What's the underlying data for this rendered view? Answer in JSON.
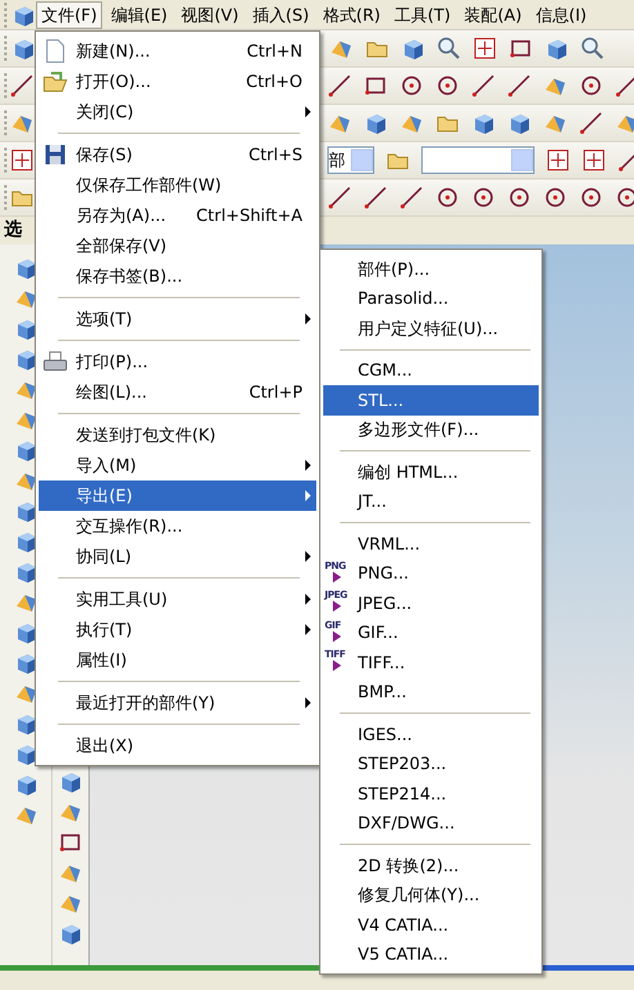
{
  "menubar": [
    {
      "label": "文件(F)",
      "selected": true
    },
    {
      "label": "编辑(E)",
      "selected": false
    },
    {
      "label": "视图(V)",
      "selected": false
    },
    {
      "label": "插入(S)",
      "selected": false
    },
    {
      "label": "格式(R)",
      "selected": false
    },
    {
      "label": "工具(T)",
      "selected": false
    },
    {
      "label": "装配(A)",
      "selected": false
    },
    {
      "label": "信息(I)",
      "selected": false
    }
  ],
  "part_combo": {
    "value": "部"
  },
  "panel_title": "选",
  "file_menu": [
    {
      "kind": "item",
      "label": "新建(N)...",
      "shortcut": "Ctrl+N",
      "submenu": false,
      "selected": false
    },
    {
      "kind": "item",
      "label": "打开(O)...",
      "shortcut": "Ctrl+O",
      "submenu": false,
      "selected": false
    },
    {
      "kind": "item",
      "label": "关闭(C)",
      "submenu": true,
      "selected": false
    },
    {
      "kind": "separator"
    },
    {
      "kind": "item",
      "label": "保存(S)",
      "shortcut": "Ctrl+S",
      "submenu": false,
      "selected": false
    },
    {
      "kind": "item",
      "label": "仅保存工作部件(W)",
      "submenu": false,
      "selected": false
    },
    {
      "kind": "item",
      "label": "另存为(A)...",
      "shortcut": "Ctrl+Shift+A",
      "submenu": false,
      "selected": false
    },
    {
      "kind": "item",
      "label": "全部保存(V)",
      "submenu": false,
      "selected": false
    },
    {
      "kind": "item",
      "label": "保存书签(B)...",
      "submenu": false,
      "selected": false
    },
    {
      "kind": "separator"
    },
    {
      "kind": "item",
      "label": "选项(T)",
      "submenu": true,
      "selected": false
    },
    {
      "kind": "separator"
    },
    {
      "kind": "item",
      "label": "打印(P)...",
      "submenu": false,
      "selected": false
    },
    {
      "kind": "item",
      "label": "绘图(L)...",
      "shortcut": "Ctrl+P",
      "submenu": false,
      "selected": false
    },
    {
      "kind": "separator"
    },
    {
      "kind": "item",
      "label": "发送到打包文件(K)",
      "submenu": false,
      "selected": false
    },
    {
      "kind": "item",
      "label": "导入(M)",
      "submenu": true,
      "selected": false
    },
    {
      "kind": "item",
      "label": "导出(E)",
      "submenu": true,
      "selected": true
    },
    {
      "kind": "item",
      "label": "交互操作(R)...",
      "submenu": false,
      "selected": false
    },
    {
      "kind": "item",
      "label": "协同(L)",
      "submenu": true,
      "selected": false
    },
    {
      "kind": "separator"
    },
    {
      "kind": "item",
      "label": "实用工具(U)",
      "submenu": true,
      "selected": false
    },
    {
      "kind": "item",
      "label": "执行(T)",
      "submenu": true,
      "selected": false
    },
    {
      "kind": "item",
      "label": "属性(I)",
      "submenu": false,
      "selected": false
    },
    {
      "kind": "separator"
    },
    {
      "kind": "item",
      "label": "最近打开的部件(Y)",
      "submenu": true,
      "selected": false
    },
    {
      "kind": "separator"
    },
    {
      "kind": "item",
      "label": "退出(X)",
      "submenu": false,
      "selected": false
    }
  ],
  "export_submenu": [
    {
      "kind": "item",
      "label": "部件(P)...",
      "selected": false
    },
    {
      "kind": "item",
      "label": "Parasolid...",
      "selected": false
    },
    {
      "kind": "item",
      "label": "用户定义特征(U)...",
      "selected": false
    },
    {
      "kind": "separator"
    },
    {
      "kind": "item",
      "label": "CGM...",
      "selected": false
    },
    {
      "kind": "item",
      "label": "STL...",
      "selected": true
    },
    {
      "kind": "item",
      "label": "多边形文件(F)...",
      "selected": false
    },
    {
      "kind": "separator"
    },
    {
      "kind": "item",
      "label": "编创 HTML...",
      "selected": false
    },
    {
      "kind": "item",
      "label": "JT...",
      "selected": false
    },
    {
      "kind": "separator"
    },
    {
      "kind": "item",
      "label": "VRML...",
      "selected": false
    },
    {
      "kind": "item",
      "badge": "PNG",
      "label": "PNG...",
      "selected": false
    },
    {
      "kind": "item",
      "badge": "JPEG",
      "label": "JPEG...",
      "selected": false
    },
    {
      "kind": "item",
      "badge": "GIF",
      "label": "GIF...",
      "selected": false
    },
    {
      "kind": "item",
      "badge": "TIFF",
      "label": "TIFF...",
      "selected": false
    },
    {
      "kind": "item",
      "label": "BMP...",
      "selected": false
    },
    {
      "kind": "separator"
    },
    {
      "kind": "item",
      "label": "IGES...",
      "selected": false
    },
    {
      "kind": "item",
      "label": "STEP203...",
      "selected": false
    },
    {
      "kind": "item",
      "label": "STEP214...",
      "selected": false
    },
    {
      "kind": "item",
      "label": "DXF/DWG...",
      "selected": false
    },
    {
      "kind": "separator"
    },
    {
      "kind": "item",
      "label": "2D 转换(2)...",
      "selected": false
    },
    {
      "kind": "item",
      "label": "修复几何体(Y)...",
      "selected": false
    },
    {
      "kind": "item",
      "label": "V4 CATIA...",
      "selected": false
    },
    {
      "kind": "item",
      "label": "V5 CATIA...",
      "selected": false
    }
  ]
}
